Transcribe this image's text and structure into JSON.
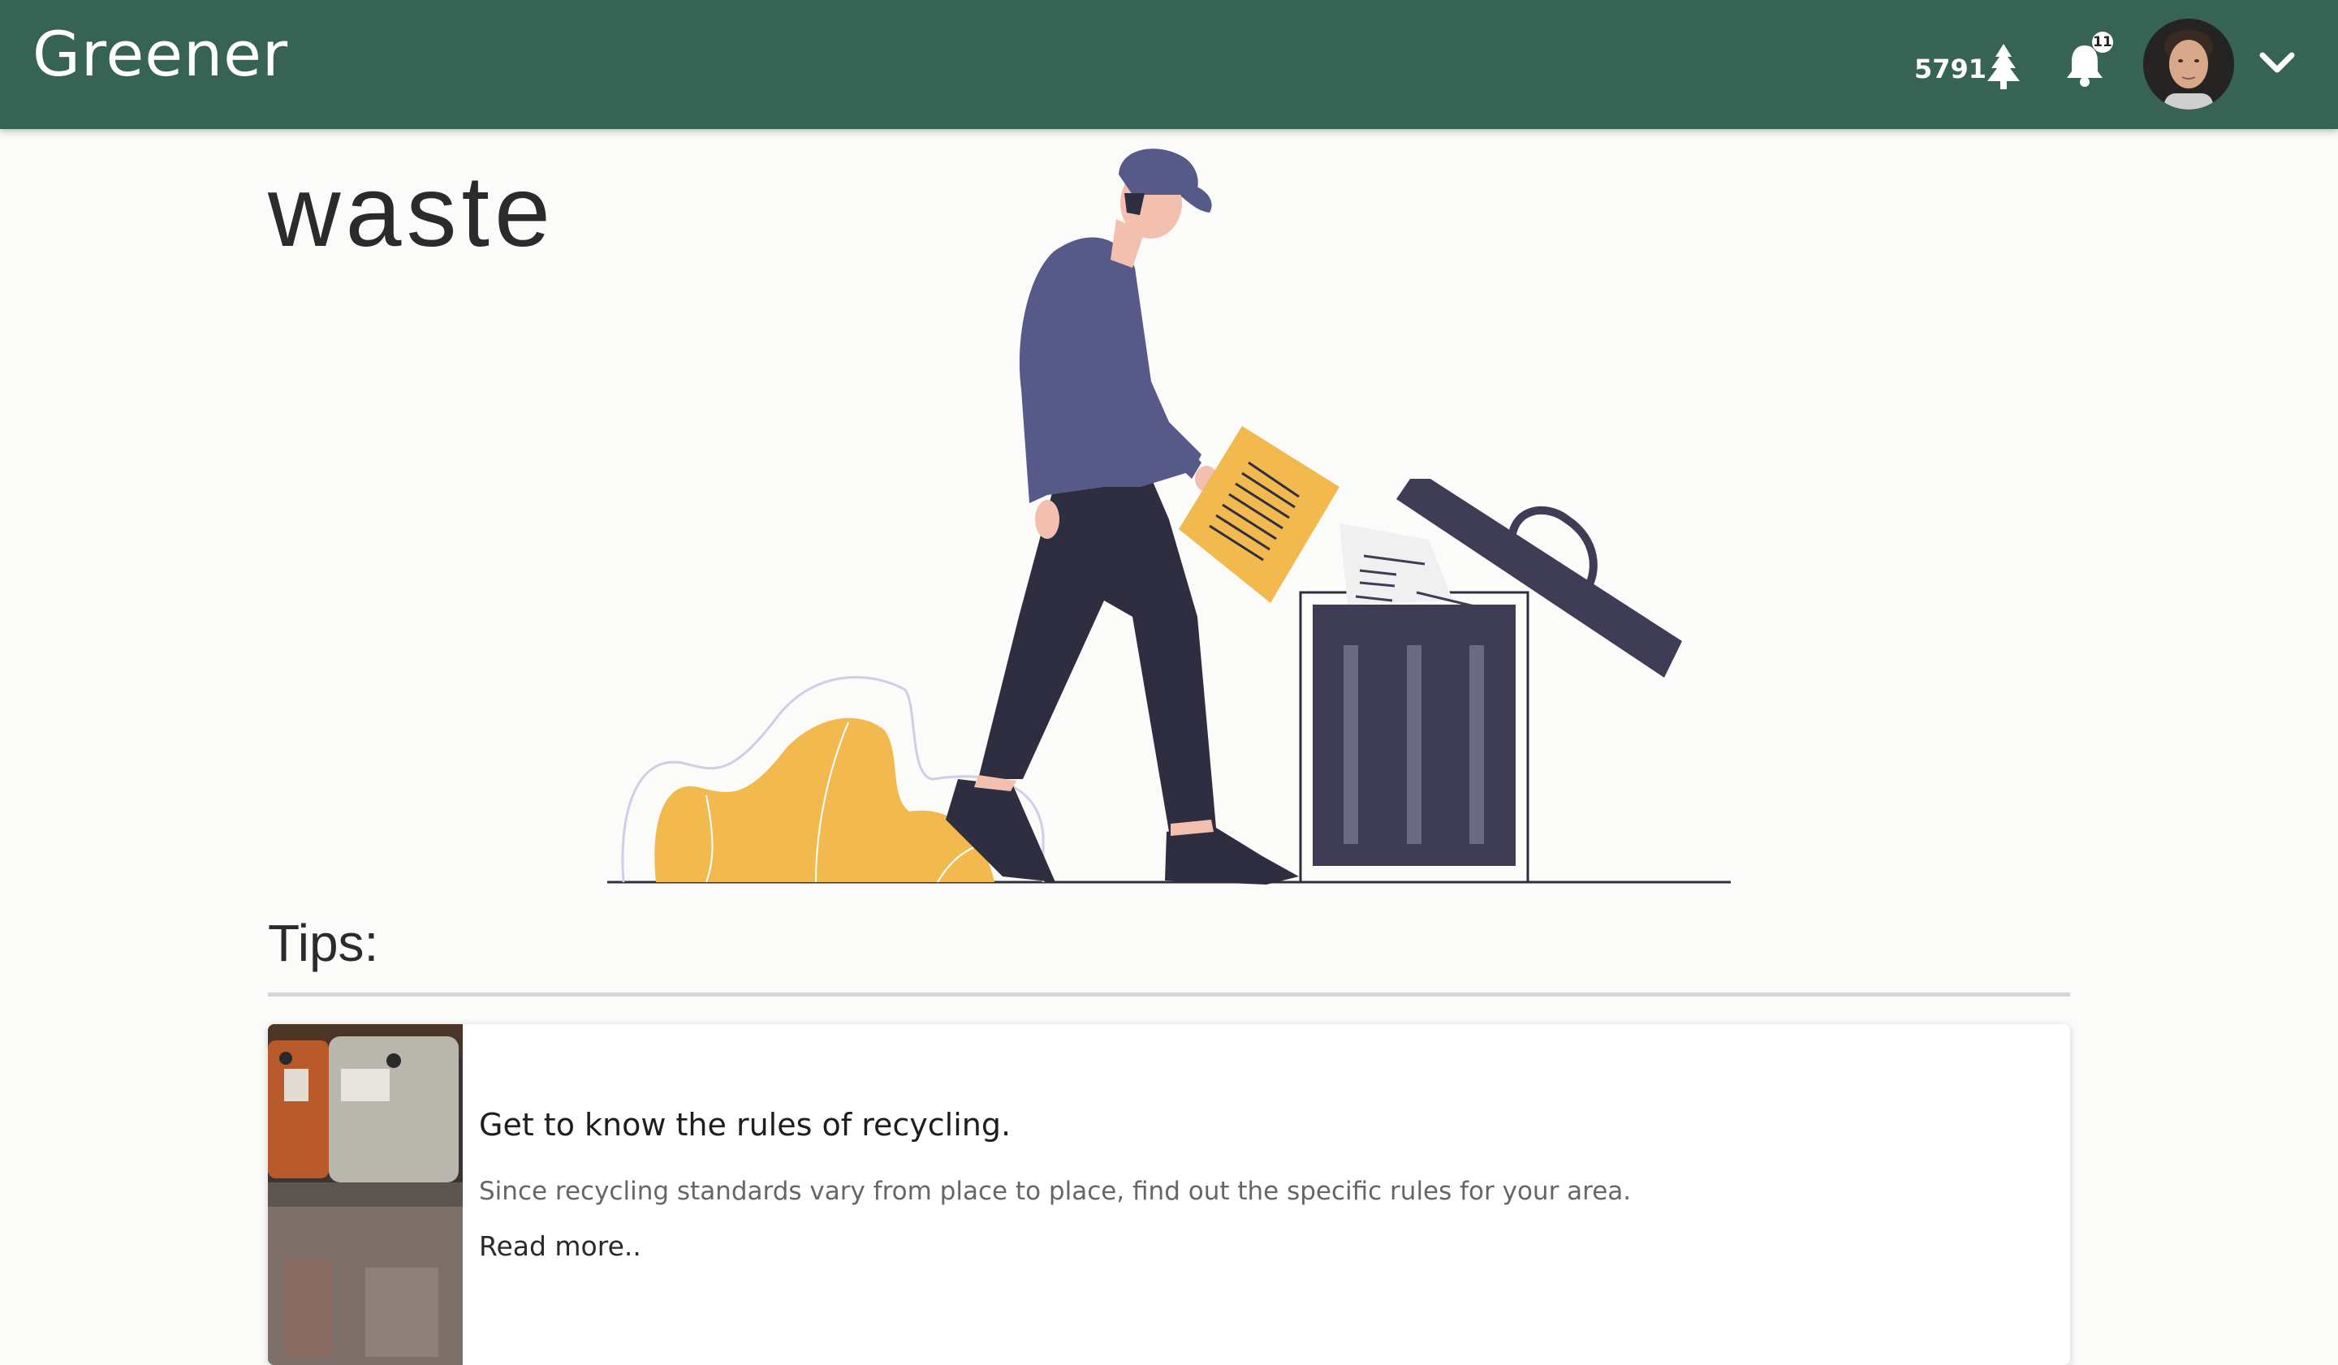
{
  "header": {
    "brand": "Greener",
    "points": "5791",
    "points_icon": "tree-icon",
    "notifications_count": "11",
    "background_color": "#376354"
  },
  "main": {
    "title": "waste",
    "tips_heading": "Tips:"
  },
  "tips": [
    {
      "title": "Get to know the rules of recycling.",
      "description": "Since recycling standards vary from place to place, find out the specific rules for your area.",
      "link": "Read more.."
    }
  ],
  "colors": {
    "accent": "#376354",
    "illustration_yellow": "#f2b94f",
    "illustration_purple": "#575a89",
    "illustration_dark": "#2f2e41"
  }
}
